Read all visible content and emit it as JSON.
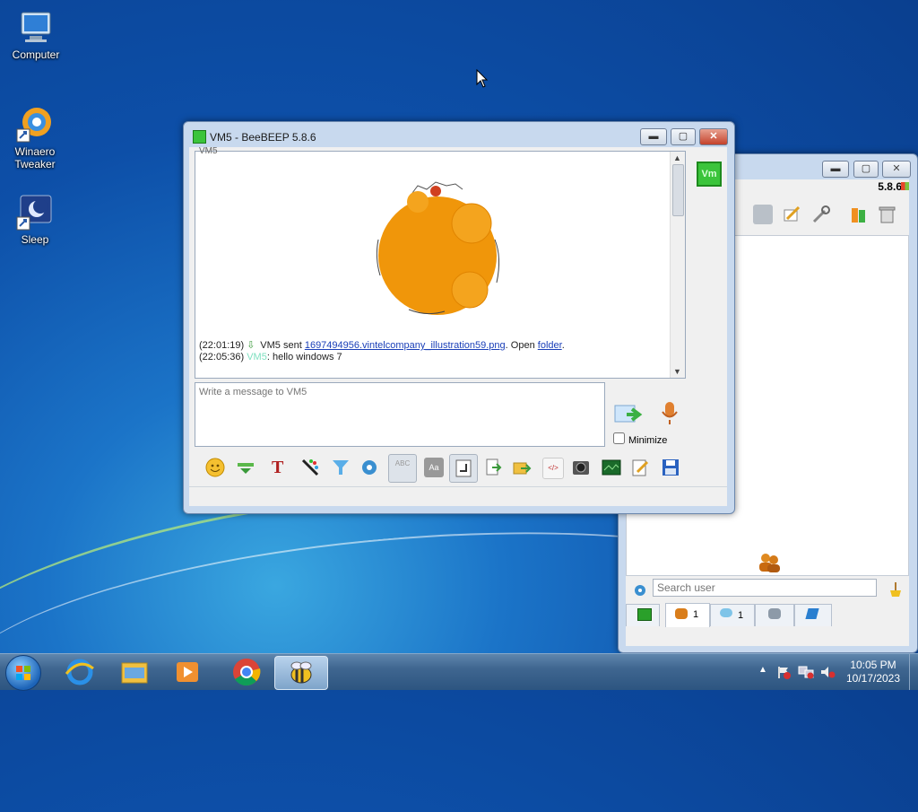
{
  "desktop": {
    "icons": [
      {
        "label": "Computer"
      },
      {
        "label_line1": "Winaero",
        "label_line2": "Tweaker"
      },
      {
        "label": "Sleep"
      }
    ]
  },
  "chat_window": {
    "title": "VM5 - BeeBEEP 5.8.6",
    "avatar_text": "Vm",
    "top_cut_text": "VM5",
    "messages": [
      {
        "time": "(22:01:19)",
        "sender": "VM5",
        "text_before": "sent",
        "link": "1697494956.vintelcompany_illustration59.png",
        "text_after": ". Open",
        "folder_link": "folder",
        "end": "."
      },
      {
        "time": "(22:05:36)",
        "sender": "VM5",
        "text": ": hello windows 7"
      }
    ],
    "input_placeholder": "Write a message to VM5",
    "minimize_label": "Minimize"
  },
  "main_window": {
    "version": "5.8.6",
    "search_placeholder": "Search user",
    "tabs": [
      {
        "icon": "vm-icon",
        "count": ""
      },
      {
        "icon": "users-icon",
        "count": "1"
      },
      {
        "icon": "chat-icon",
        "count": "1"
      },
      {
        "icon": "groups-icon",
        "count": ""
      },
      {
        "icon": "share-icon",
        "count": ""
      }
    ]
  },
  "taskbar": {
    "time": "10:05 PM",
    "date": "10/17/2023"
  },
  "colors": {
    "accent_green": "#3bc43b",
    "image_orange": "#f0960a",
    "link": "#1a3fb8"
  }
}
